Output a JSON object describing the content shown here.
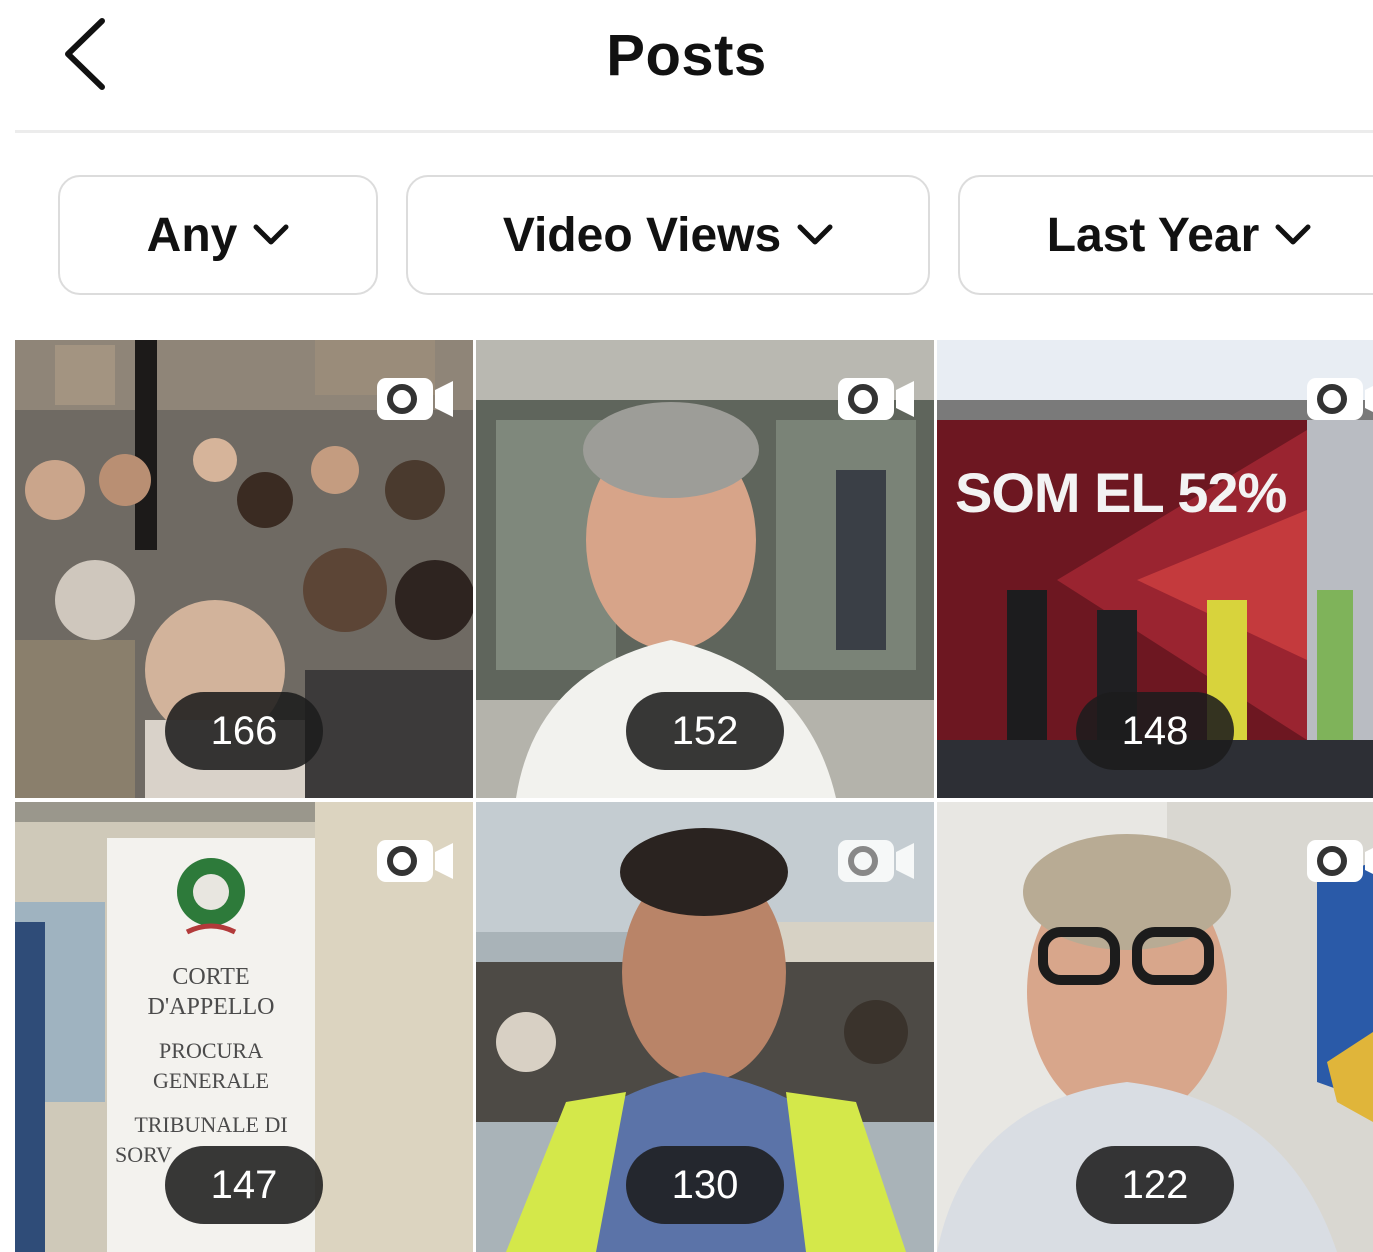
{
  "header": {
    "title": "Posts",
    "back_icon": "chevron-left-icon"
  },
  "filters": [
    {
      "label": "Any",
      "icon": "chevron-down-icon"
    },
    {
      "label": "Video Views",
      "icon": "chevron-down-icon"
    },
    {
      "label": "Last Year",
      "icon": "chevron-down-icon"
    }
  ],
  "posts": [
    {
      "count": "166",
      "icon": "video-camera-icon"
    },
    {
      "count": "152",
      "icon": "video-camera-icon"
    },
    {
      "count": "148",
      "icon": "video-camera-icon",
      "poster_text": "SOM EL 52%"
    },
    {
      "count": "147",
      "icon": "video-camera-icon",
      "sign_text": [
        "CORTE",
        "D'APPELLO",
        "PROCURA",
        "GENERALE",
        "TRIBUNALE DI",
        "SORV"
      ]
    },
    {
      "count": "130",
      "icon": "video-camera-icon"
    },
    {
      "count": "122",
      "icon": "video-camera-icon"
    }
  ]
}
